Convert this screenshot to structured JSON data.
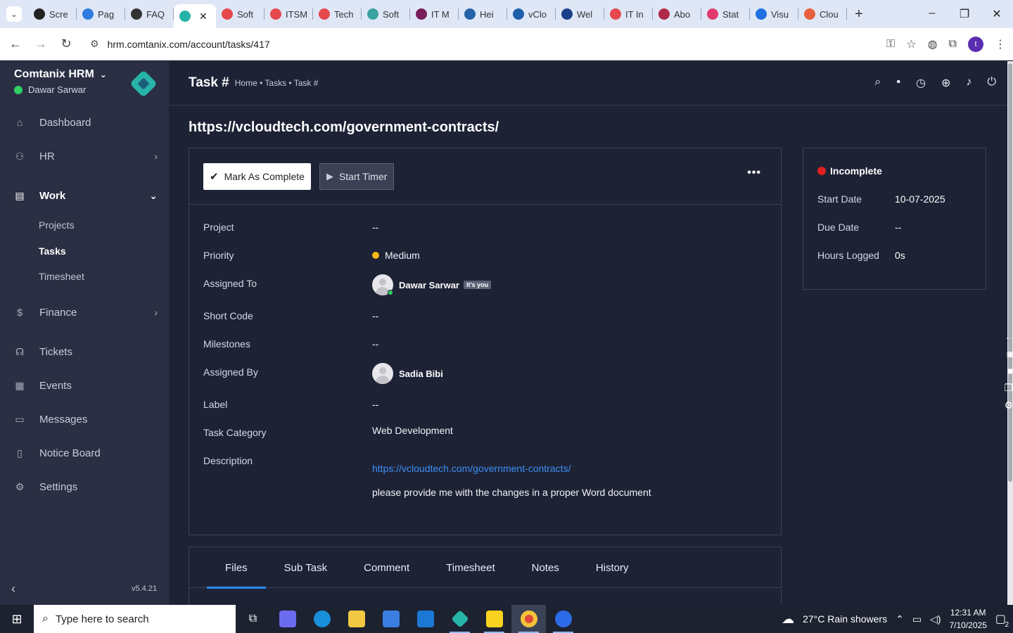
{
  "browser": {
    "tabs": [
      {
        "label": "Scre",
        "color": "#222222"
      },
      {
        "label": "Pag",
        "color": "#2f7de1"
      },
      {
        "label": "FAQ",
        "color": "#333333"
      },
      {
        "label": "",
        "color": "#27b3a8",
        "active": true
      },
      {
        "label": "Soft",
        "color": "#e5484d"
      },
      {
        "label": "ITSM",
        "color": "#e5484d"
      },
      {
        "label": "Tech",
        "color": "#e5484d"
      },
      {
        "label": "Soft",
        "color": "#3aa3a0"
      },
      {
        "label": "IT M",
        "color": "#7a1d5a"
      },
      {
        "label": "Hei",
        "color": "#2463a8"
      },
      {
        "label": "vClo",
        "color": "#1f5ea8"
      },
      {
        "label": "Wel",
        "color": "#1b3f8a"
      },
      {
        "label": "IT In",
        "color": "#e5484d"
      },
      {
        "label": "Abo",
        "color": "#b0284a"
      },
      {
        "label": "Stat",
        "color": "#e23a6e"
      },
      {
        "label": "Visu",
        "color": "#1f6fe0"
      },
      {
        "label": "Clou",
        "color": "#e8603c"
      }
    ],
    "url": "hrm.comtanix.com/account/tasks/417",
    "profile_initial": "t"
  },
  "sidebar": {
    "brand": "Comtanix HRM",
    "user": "Dawar Sarwar",
    "menu": {
      "dashboard": "Dashboard",
      "hr": "HR",
      "work": "Work",
      "finance": "Finance",
      "tickets": "Tickets",
      "events": "Events",
      "messages": "Messages",
      "notice_board": "Notice Board",
      "settings": "Settings"
    },
    "work_sub": {
      "projects": "Projects",
      "tasks": "Tasks",
      "timesheet": "Timesheet"
    },
    "version": "v5.4.21"
  },
  "header": {
    "title": "Task #",
    "breadcrumb": "Home • Tasks • Task #"
  },
  "task": {
    "heading": "https://vcloudtech.com/government-contracts/",
    "actions": {
      "complete": "Mark As Complete",
      "timer": "Start Timer",
      "more": "•••"
    },
    "fields": {
      "project_label": "Project",
      "project_value": "--",
      "priority_label": "Priority",
      "priority_value": "Medium",
      "assigned_to_label": "Assigned To",
      "assigned_to_value": "Dawar Sarwar",
      "its_you": "It's you",
      "short_code_label": "Short Code",
      "short_code_value": "--",
      "milestones_label": "Milestones",
      "milestones_value": "--",
      "assigned_by_label": "Assigned By",
      "assigned_by_value": "Sadia Bibi",
      "label_label": "Label",
      "label_value": "--",
      "category_label": "Task Category",
      "category_value": "Web Development",
      "description_label": "Description",
      "description_link": "https://vcloudtech.com/government-contracts/",
      "description_text": "please provide me with the changes in a proper Word document"
    }
  },
  "status": {
    "state": "Incomplete",
    "start_label": "Start Date",
    "start_value": "10-07-2025",
    "due_label": "Due Date",
    "due_value": "--",
    "hours_label": "Hours Logged",
    "hours_value": "0s"
  },
  "detail_tabs": [
    "Files",
    "Sub Task",
    "Comment",
    "Timesheet",
    "Notes",
    "History"
  ],
  "taskbar": {
    "search_placeholder": "Type here to search",
    "weather": "27°C  Rain showers",
    "time": "12:31 AM",
    "date": "7/10/2025",
    "notif_count": "2"
  }
}
